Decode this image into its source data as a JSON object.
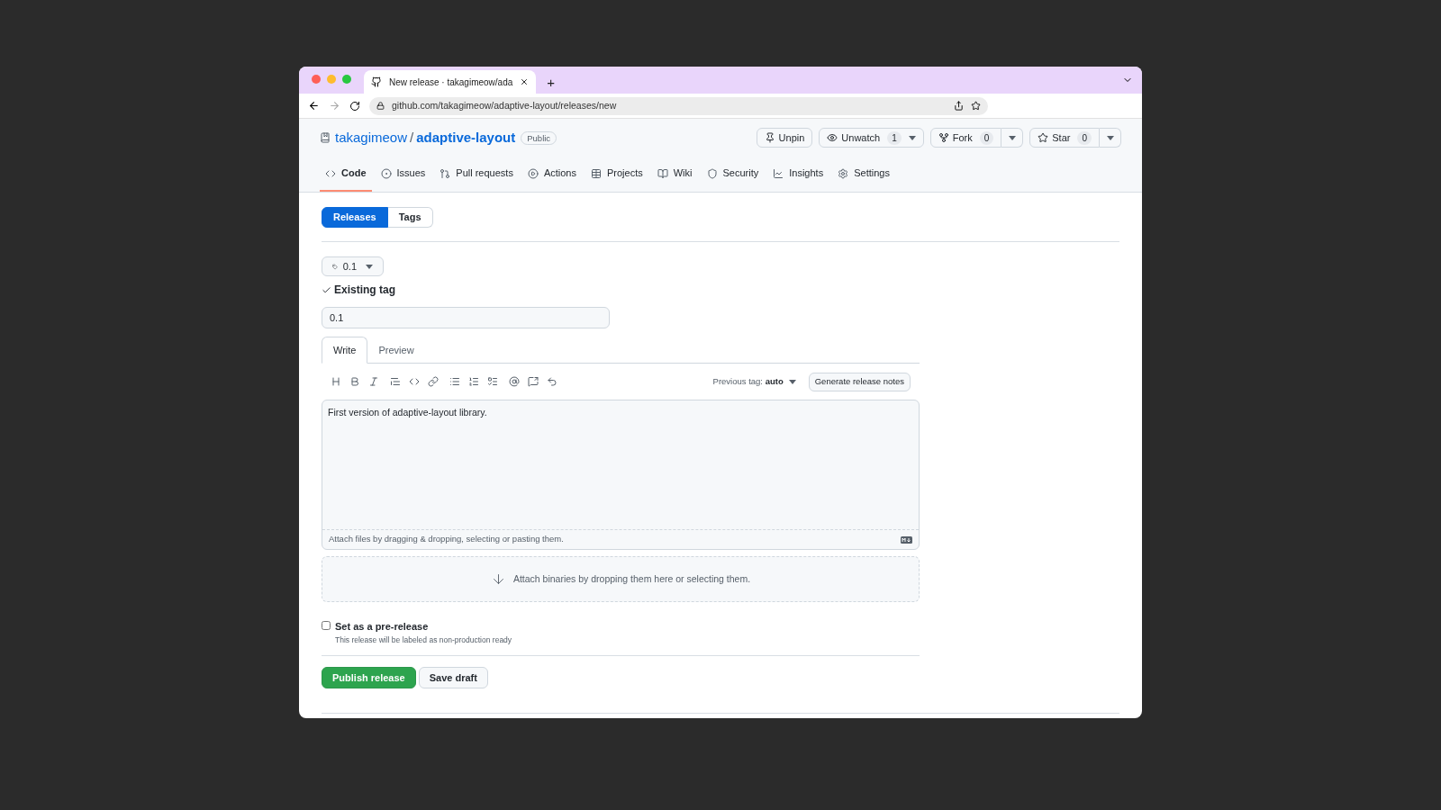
{
  "browser": {
    "tab_title": "New release · takagimeow/ada",
    "new_tab": "+",
    "url": "github.com/takagimeow/adaptive-layout/releases/new"
  },
  "repo": {
    "owner": "takagimeow",
    "separator": "/",
    "name": "adaptive-layout",
    "visibility": "Public"
  },
  "repo_actions": [
    {
      "kind": "plain",
      "label": "Unpin"
    },
    {
      "kind": "caret",
      "label": "Unwatch",
      "count": "1"
    },
    {
      "kind": "split",
      "label": "Fork",
      "count": "0"
    },
    {
      "kind": "split",
      "label": "Star",
      "count": "0"
    }
  ],
  "nav": [
    {
      "label": "Code",
      "selected": true
    },
    {
      "label": "Issues",
      "selected": false
    },
    {
      "label": "Pull requests",
      "selected": false
    },
    {
      "label": "Actions",
      "selected": false
    },
    {
      "label": "Projects",
      "selected": false
    },
    {
      "label": "Wiki",
      "selected": false
    },
    {
      "label": "Security",
      "selected": false
    },
    {
      "label": "Insights",
      "selected": false
    },
    {
      "label": "Settings",
      "selected": false
    }
  ],
  "subnav": [
    {
      "label": "Releases",
      "selected": true
    },
    {
      "label": "Tags",
      "selected": false
    }
  ],
  "tag_picker": {
    "value": "0.1"
  },
  "tag_status": "Existing tag",
  "title_field": {
    "value": "0.1"
  },
  "editor_tabs": [
    {
      "label": "Write",
      "selected": true
    },
    {
      "label": "Preview",
      "selected": false
    }
  ],
  "previous_tag": {
    "label": "Previous tag:",
    "value": "auto"
  },
  "generate_button": "Generate release notes",
  "body": "First version of adaptive-layout library.",
  "attach_hint": "Attach files by dragging & dropping, selecting or pasting them.",
  "drop_zone": "Attach binaries by dropping them here or selecting them.",
  "prerelease": {
    "label": "Set as a pre-release",
    "description": "This release will be labeled as non-production ready",
    "checked": false
  },
  "buttons": [
    {
      "kind": "primary",
      "label": "Publish release"
    },
    {
      "kind": "secondary",
      "label": "Save draft"
    }
  ]
}
